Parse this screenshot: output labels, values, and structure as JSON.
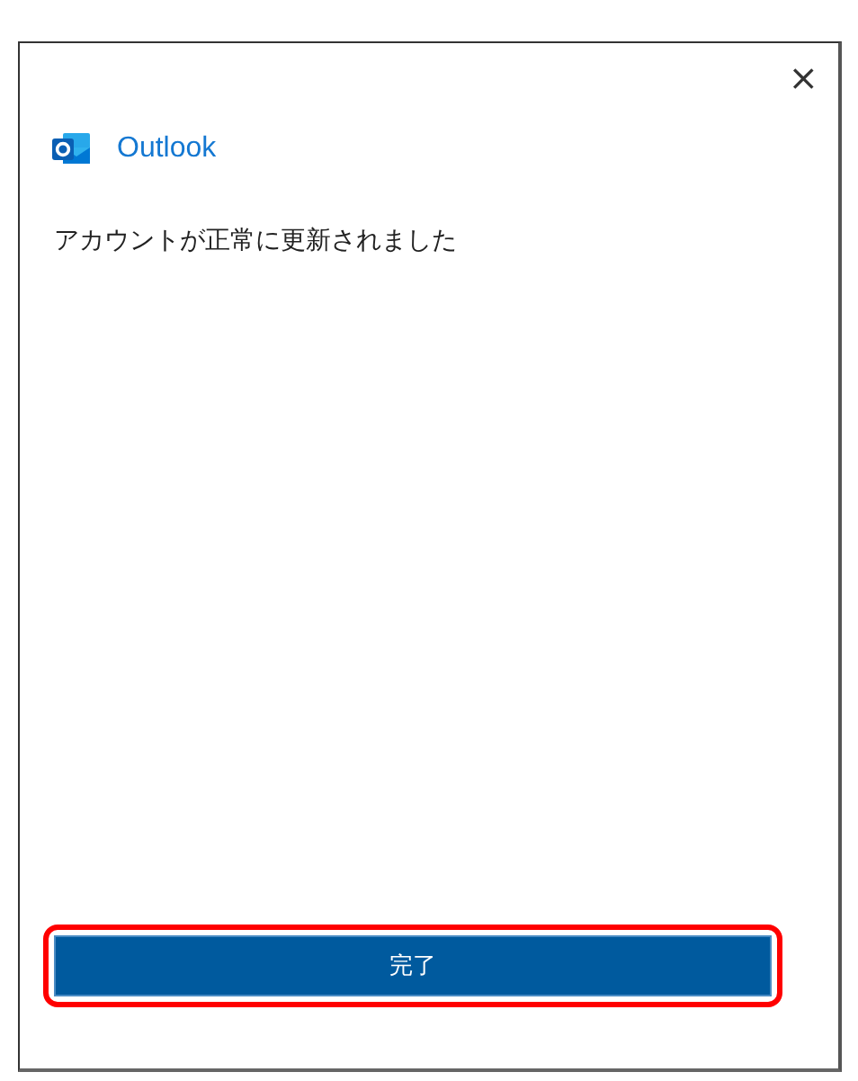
{
  "dialog": {
    "close": "×",
    "app_name": "Outlook",
    "message": "アカウントが正常に更新されました",
    "button": {
      "label": "完了",
      "highlighted": true
    }
  }
}
